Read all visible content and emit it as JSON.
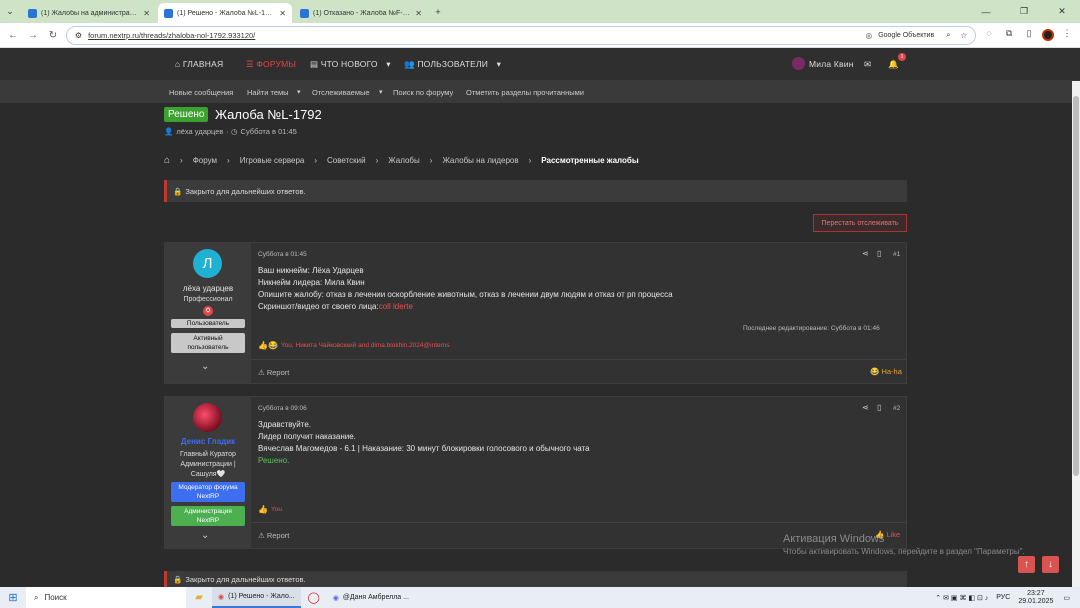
{
  "browser": {
    "tabs": [
      {
        "title": "(1) Жалобы на администрацию",
        "active": false
      },
      {
        "title": "(1) Решено - Жалоба №L-1792",
        "active": true
      },
      {
        "title": "(1) Отказано - Жалоба №F-189",
        "active": false
      }
    ],
    "url": "forum.nextrp.ru/threads/zhaloba-nol-1792.933120/",
    "lens_label": "Google Объектив"
  },
  "topnav": {
    "home": "ГЛАВНАЯ",
    "forums": "ФОРУМЫ",
    "whats_new": "ЧТО НОВОГО",
    "members": "ПОЛЬЗОВАТЕЛИ",
    "user": "Мила Квин",
    "alerts_count": "1"
  },
  "subnav": [
    "Новые сообщения",
    "Найти темы",
    "Отслеживаемые",
    "Поиск по форуму",
    "Отметить разделы прочитанными"
  ],
  "thread": {
    "prefix": "Решено",
    "title": "Жалоба №L-1792",
    "author": "лёха ударцев",
    "date": "Суббота в 01:45"
  },
  "breadcrumb": [
    "Форум",
    "Игровые сервера",
    "Советский",
    "Жалобы",
    "Жалобы на лидеров",
    "Рассмотренные жалобы"
  ],
  "closed_notice": "Закрыто для дальнейших ответов.",
  "unwatch_button": "Перестать отслеживать",
  "posts": [
    {
      "avatar_letter": "Л",
      "user": "лёха ударцев",
      "user_title": "Профессионал",
      "badges": [
        "Пользователь",
        "Активный пользователь"
      ],
      "date": "Суббота в 01:45",
      "number": "#1",
      "lines": [
        "Ваш никнейм: Лёха Ударцев",
        "Никнейм лидера: Мила Квин",
        "Опишите жалобу: отказ в лечении оскорбление животным, отказ в лечении двум людям и отказ от рп процесса"
      ],
      "evidence_label": "Скриншот/видео от своего лица:",
      "evidence_link": "coll lderte",
      "edited": "Последнее редактирование: Суббота в 01:46",
      "reactions": "You, Никита Чайковсккий and dima.blokhin.2024@interns",
      "report": "Report",
      "reaction_label": "Ha-ha"
    },
    {
      "user": "Денис Гладик",
      "user_title": "Главный Куратор Администрации | Сашуля🤍",
      "badges": [
        "Модератор форума NextRP",
        "Администрация NextRP"
      ],
      "date": "Суббота в 09:06",
      "number": "#2",
      "lines": [
        "Здравствуйте.",
        "Лидер получит наказание.",
        "Вячеслав Магомедов - 6.1 | Наказание: 30 минут блокировки голосового и обычного чата"
      ],
      "status": "Решено.",
      "reactions": "You",
      "report": "Report",
      "reaction_label": "Like"
    }
  ],
  "watermark": {
    "line1": "Активация Windows",
    "line2": "Чтобы активировать Windows, перейдите в раздел \"Параметры\"."
  },
  "taskbar": {
    "search": "Поиск",
    "apps": [
      "(1) Решено - Жало...",
      "@Даня Амбрелла ..."
    ],
    "lang": "РУС",
    "time": "23:27",
    "date": "29.01.2025"
  },
  "colors": {
    "accent": "#e0454b",
    "solved": "#3da12f",
    "link": "#e5504f",
    "bg": "#2b2b2b"
  }
}
